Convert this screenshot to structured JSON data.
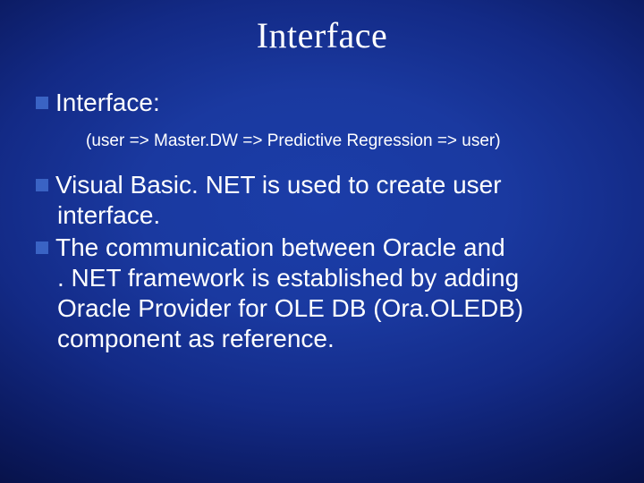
{
  "title": "Interface",
  "bullets": {
    "b1": "Interface:",
    "sub1": "(user => Master.DW => Predictive Regression => user)",
    "b2_l1": "Visual Basic. NET is used to create user",
    "b2_l2": "interface.",
    "b3_l1": "The communication between Oracle and",
    "b3_l2": ". NET framework is established by adding",
    "b3_l3": "Oracle Provider for OLE DB (Ora.OLEDB)",
    "b3_l4": "component as reference."
  }
}
